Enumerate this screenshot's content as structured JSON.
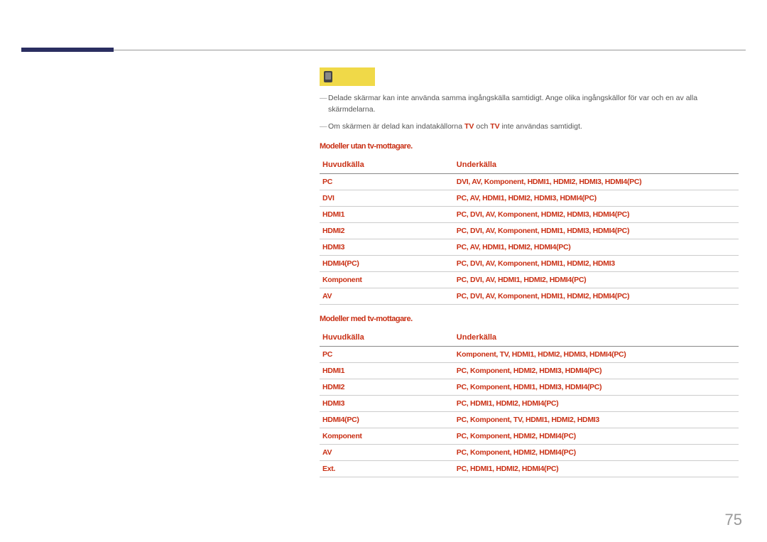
{
  "page_number": "75",
  "note1": "Delade skärmar kan inte använda samma ingångskälla samtidigt. Ange olika ingångskällor för var och en av alla skärmdelarna.",
  "note2_prefix": "Om skärmen är delad kan indatakällorna ",
  "note2_src1": "TV",
  "note2_mid": " och ",
  "note2_src2": "TV",
  "note2_suffix": " inte användas samtidigt.",
  "section1_title": "Modeller utan tv-mottagare.",
  "table1": {
    "headers": [
      "Huvudkälla",
      "Underkälla"
    ],
    "rows": [
      [
        "PC",
        "DVI, AV, Komponent, HDMI1, HDMI2, HDMI3, HDMI4(PC)"
      ],
      [
        "DVI",
        "PC, AV, HDMI1, HDMI2, HDMI3, HDMI4(PC)"
      ],
      [
        "HDMI1",
        "PC, DVI, AV, Komponent, HDMI2, HDMI3, HDMI4(PC)"
      ],
      [
        "HDMI2",
        "PC, DVI, AV, Komponent, HDMI1, HDMI3, HDMI4(PC)"
      ],
      [
        "HDMI3",
        "PC, AV, HDMI1, HDMI2, HDMI4(PC)"
      ],
      [
        "HDMI4(PC)",
        "PC, DVI, AV, Komponent, HDMI1, HDMI2, HDMI3"
      ],
      [
        "Komponent",
        "PC, DVI, AV, HDMI1, HDMI2, HDMI4(PC)"
      ],
      [
        "AV",
        "PC, DVI, AV, Komponent, HDMI1, HDMI2, HDMI4(PC)"
      ]
    ]
  },
  "section2_title": "Modeller med tv-mottagare.",
  "table2": {
    "headers": [
      "Huvudkälla",
      "Underkälla"
    ],
    "rows": [
      [
        "PC",
        "Komponent, TV, HDMI1, HDMI2, HDMI3, HDMI4(PC)"
      ],
      [
        "HDMI1",
        "PC, Komponent, HDMI2, HDMI3, HDMI4(PC)"
      ],
      [
        "HDMI2",
        "PC, Komponent, HDMI1, HDMI3, HDMI4(PC)"
      ],
      [
        "HDMI3",
        "PC, HDMI1, HDMI2, HDMI4(PC)"
      ],
      [
        "HDMI4(PC)",
        "PC, Komponent, TV, HDMI1, HDMI2, HDMI3"
      ],
      [
        "Komponent",
        "PC, Komponent, HDMI2, HDMI4(PC)"
      ],
      [
        "AV",
        "PC, Komponent, HDMI2, HDMI4(PC)"
      ],
      [
        "Ext.",
        "PC, HDMI1, HDMI2, HDMI4(PC)"
      ]
    ]
  }
}
